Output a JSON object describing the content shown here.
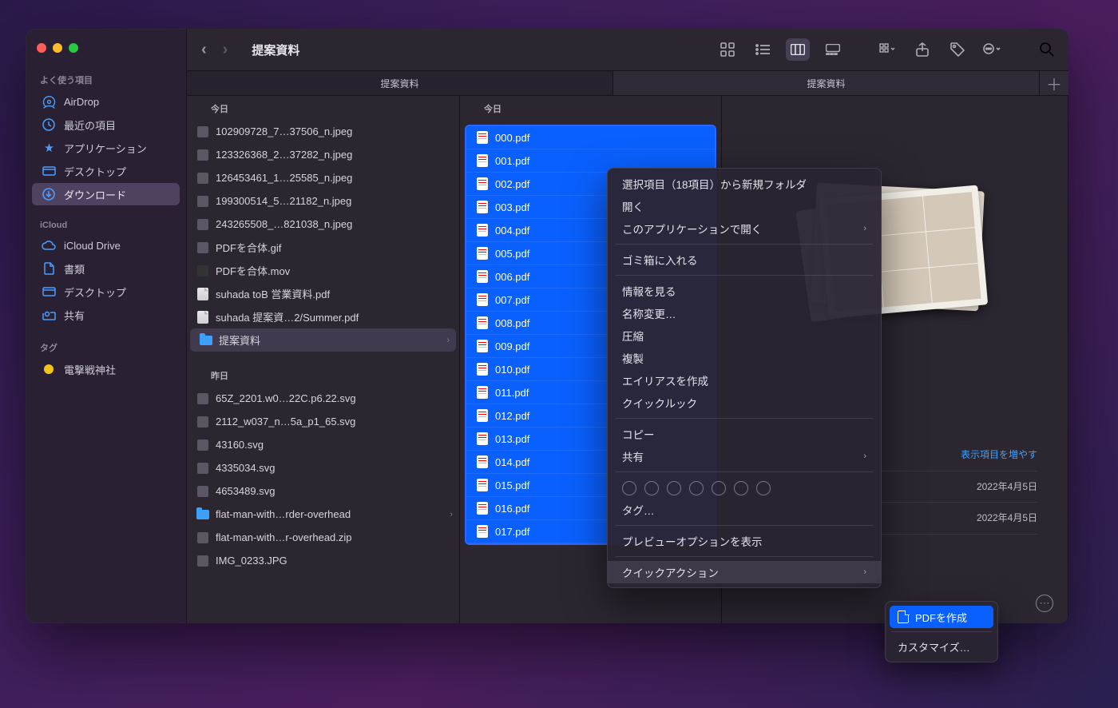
{
  "title": "提案資料",
  "sidebar": {
    "sections": [
      {
        "heading": "よく使う項目",
        "items": [
          {
            "icon": "airdrop",
            "label": "AirDrop",
            "active": false
          },
          {
            "icon": "clock",
            "label": "最近の項目",
            "active": false
          },
          {
            "icon": "apps",
            "label": "アプリケーション",
            "active": false
          },
          {
            "icon": "desktop",
            "label": "デスクトップ",
            "active": false
          },
          {
            "icon": "download",
            "label": "ダウンロード",
            "active": true
          }
        ]
      },
      {
        "heading": "iCloud",
        "items": [
          {
            "icon": "cloud",
            "label": "iCloud Drive",
            "active": false
          },
          {
            "icon": "doc",
            "label": "書類",
            "active": false
          },
          {
            "icon": "desktop2",
            "label": "デスクトップ",
            "active": false
          },
          {
            "icon": "share",
            "label": "共有",
            "active": false
          }
        ]
      },
      {
        "heading": "タグ",
        "items": [
          {
            "icon": "tag-yellow",
            "label": "電撃戦神社",
            "active": false
          }
        ]
      }
    ]
  },
  "tabs": [
    "提案資料",
    "提案資料"
  ],
  "tab_plus": "＋",
  "column1": {
    "sections": [
      {
        "heading": "今日",
        "rows": [
          {
            "t": "img",
            "name": "102909728_7…37506_n.jpeg"
          },
          {
            "t": "img",
            "name": "123326368_2…37282_n.jpeg"
          },
          {
            "t": "img",
            "name": "126453461_1…25585_n.jpeg"
          },
          {
            "t": "img",
            "name": "199300514_5…21182_n.jpeg"
          },
          {
            "t": "img",
            "name": "243265508_…821038_n.jpeg"
          },
          {
            "t": "gif",
            "name": "PDFを合体.gif"
          },
          {
            "t": "mov",
            "name": "PDFを合体.mov"
          },
          {
            "t": "pdf",
            "name": "suhada toB 営業資料.pdf"
          },
          {
            "t": "pdf",
            "name": "suhada 提案資…2/Summer.pdf"
          },
          {
            "t": "folder",
            "name": "提案資料",
            "selected": true,
            "chev": true
          }
        ]
      },
      {
        "heading": "昨日",
        "rows": [
          {
            "t": "svg",
            "name": "65Z_2201.w0…22C.p6.22.svg"
          },
          {
            "t": "svg",
            "name": "2112_w037_n…5a_p1_65.svg"
          },
          {
            "t": "svg",
            "name": "43160.svg"
          },
          {
            "t": "svg",
            "name": "4335034.svg"
          },
          {
            "t": "svg",
            "name": "4653489.svg"
          },
          {
            "t": "folder",
            "name": "flat-man-with…rder-overhead",
            "chev": true
          },
          {
            "t": "zip",
            "name": "flat-man-with…r-overhead.zip"
          },
          {
            "t": "img",
            "name": "IMG_0233.JPG"
          }
        ]
      }
    ]
  },
  "column2": {
    "heading": "今日",
    "files": [
      "000.pdf",
      "001.pdf",
      "002.pdf",
      "003.pdf",
      "004.pdf",
      "005.pdf",
      "006.pdf",
      "007.pdf",
      "008.pdf",
      "009.pdf",
      "010.pdf",
      "011.pdf",
      "012.pdf",
      "013.pdf",
      "014.pdf",
      "015.pdf",
      "016.pdf",
      "017.pdf"
    ]
  },
  "preview": {
    "more_link": "表示項目を増やす",
    "date1": "2022年4月5日",
    "date2": "2022年4月5日"
  },
  "context_menu": {
    "items": [
      {
        "label": "選択項目（18項目）から新規フォルダ",
        "type": "item"
      },
      {
        "label": "開く",
        "type": "item"
      },
      {
        "label": "このアプリケーションで開く",
        "type": "sub"
      },
      {
        "type": "sep"
      },
      {
        "label": "ゴミ箱に入れる",
        "type": "item"
      },
      {
        "type": "sep"
      },
      {
        "label": "情報を見る",
        "type": "item"
      },
      {
        "label": "名称変更…",
        "type": "item"
      },
      {
        "label": "圧縮",
        "type": "item"
      },
      {
        "label": "複製",
        "type": "item"
      },
      {
        "label": "エイリアスを作成",
        "type": "item"
      },
      {
        "label": "クイックルック",
        "type": "item"
      },
      {
        "type": "sep"
      },
      {
        "label": "コピー",
        "type": "item"
      },
      {
        "label": "共有",
        "type": "sub"
      },
      {
        "type": "sep"
      },
      {
        "type": "tags"
      },
      {
        "label": "タグ…",
        "type": "item"
      },
      {
        "type": "sep"
      },
      {
        "label": "プレビューオプションを表示",
        "type": "item"
      },
      {
        "type": "sep"
      },
      {
        "label": "クイックアクション",
        "type": "sub",
        "hl": true
      }
    ]
  },
  "submenu": {
    "create": "PDFを作成",
    "customize": "カスタマイズ…"
  }
}
